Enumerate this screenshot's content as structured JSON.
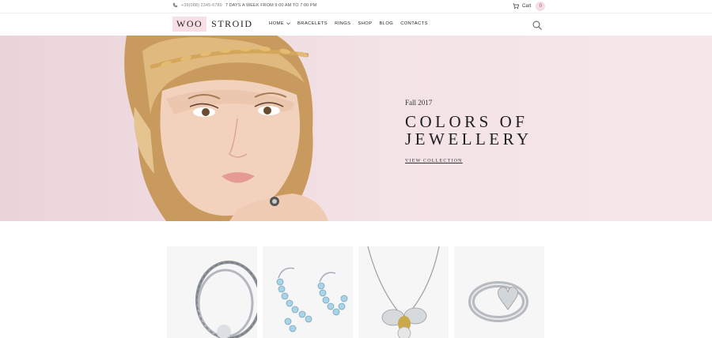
{
  "topbar": {
    "phone": "+38(088) 2345-6789",
    "hours": "7 DAYS A WEEK FROM 9:00 AM TO 7:00 PM",
    "cart_label": "Cart",
    "cart_count": "0"
  },
  "header": {
    "logo_part1": "WOO",
    "logo_part2": "STROID",
    "nav": [
      "HOME",
      "BRACELETS",
      "RINGS",
      "SHOP",
      "BLOG",
      "CONTACTS"
    ]
  },
  "hero": {
    "eyebrow": "Fall 2017",
    "title_line1": "COLORS OF",
    "title_line2": "JEWELLERY",
    "cta": "VIEW COLLECTION"
  },
  "products": [
    {
      "icon": "chain-bracelet-image"
    },
    {
      "icon": "crystal-hoop-earrings-image"
    },
    {
      "icon": "bee-pendant-necklace-image"
    },
    {
      "icon": "heart-tag-ring-image"
    }
  ],
  "colors": {
    "accent_pink": "#f7dfe5",
    "hero_bg": "#f3e2e6"
  }
}
